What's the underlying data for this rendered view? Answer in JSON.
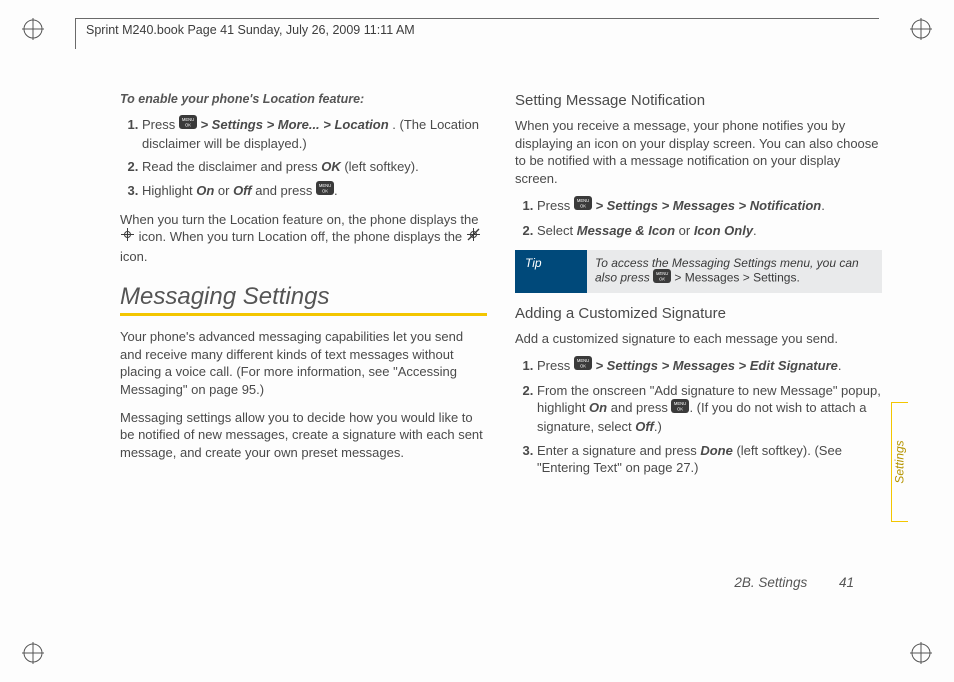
{
  "header_line": "Sprint M240.book  Page 41  Sunday, July 26, 2009  11:11 AM",
  "left": {
    "caption": "To enable your phone's Location feature:",
    "step1_a": "Press ",
    "step1_path": " > Settings > More... > Location",
    "step1_b": ". (The Location disclaimer will be displayed.)",
    "step2_a": "Read the disclaimer and press ",
    "step2_ok": "OK",
    "step2_b": " (left softkey).",
    "step3_a": "Highlight ",
    "step3_on": "On",
    "step3_or": " or ",
    "step3_off": "Off",
    "step3_b": " and press ",
    "step3_c": ".",
    "loc_para_a": "When you turn the Location feature on, the phone displays the ",
    "loc_para_b": " icon. When you turn Location off, the phone displays the ",
    "loc_para_c": " icon.",
    "section_title": "Messaging Settings",
    "msg_para1": "Your phone's advanced messaging capabilities let you send and receive many different kinds of text messages without placing a voice call. (For more information, see \"Accessing Messaging\" on page 95.)",
    "msg_para2": "Messaging settings allow you to decide how you would like to be notified of new messages, create a signature with each sent message, and create your own preset messages."
  },
  "right": {
    "sub1": "Setting Message Notification",
    "sub1_para": "When you receive a message, your phone notifies you by displaying an icon on your display screen. You can also choose to be notified with a message notification on your display screen.",
    "s1_a": "Press ",
    "s1_path": " > Settings > Messages > Notification",
    "s1_b": ".",
    "s2_a": "Select ",
    "s2_opt1": "Message & Icon",
    "s2_or": " or ",
    "s2_opt2": "Icon Only",
    "s2_b": ".",
    "tip_label": "Tip",
    "tip_a": "To access the Messaging Settings menu, you can also press ",
    "tip_path": " > Messages > Settings.",
    "sub2": "Adding a Customized Signature",
    "sub2_para": "Add a customized signature to each message you send.",
    "t1_a": "Press ",
    "t1_path": " > Settings > Messages > Edit Signature",
    "t1_b": ".",
    "t2_a": "From the onscreen \"Add signature to new Message\" popup, highlight ",
    "t2_on": "On",
    "t2_b": " and press ",
    "t2_c": ". (If you do not wish to attach a signature, select ",
    "t2_off": "Off",
    "t2_d": ".)",
    "t3_a": "Enter a signature and press ",
    "t3_done": "Done",
    "t3_b": " (left softkey). (See \"Entering Text\" on page 27.)"
  },
  "side_tab": "Settings",
  "footer_section": "2B. Settings",
  "footer_page": "41"
}
